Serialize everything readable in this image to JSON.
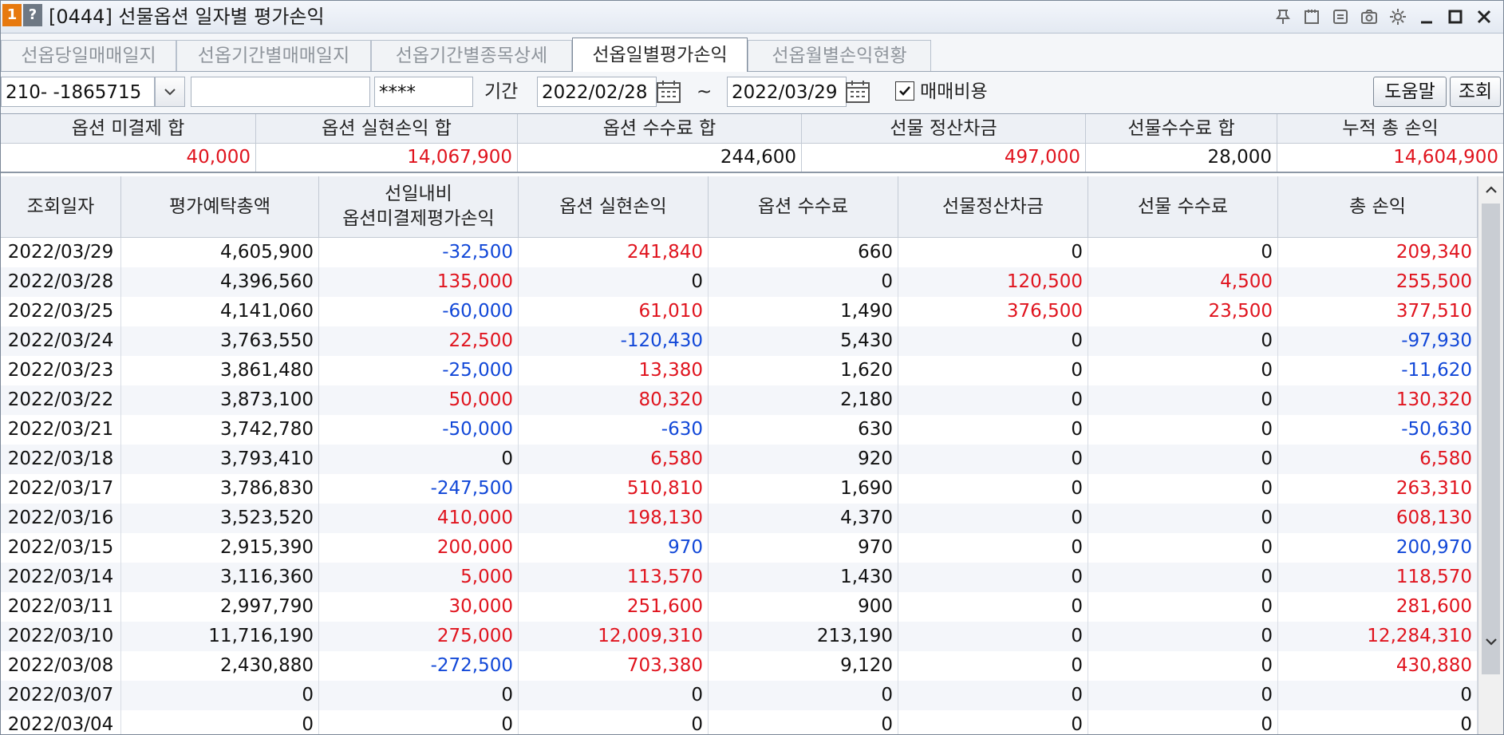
{
  "window": {
    "badge1": "1",
    "badge2": "?",
    "title": "[0444] 선물옵션 일자별 평가손익",
    "icons": [
      "pin-icon",
      "memo-icon",
      "link-icon",
      "camera-icon",
      "gear-icon",
      "minimize-icon",
      "maximize-icon",
      "close-icon"
    ]
  },
  "tabs": [
    {
      "label": "선옵당일매매일지",
      "active": false
    },
    {
      "label": "선옵기간별매매일지",
      "active": false
    },
    {
      "label": "선옵기간별종목상세",
      "active": false
    },
    {
      "label": "선옵일별평가손익",
      "active": true
    },
    {
      "label": "선옵월별손익현황",
      "active": false
    }
  ],
  "search": {
    "account": "210-    -1865715",
    "account_name": "",
    "password": "****",
    "period_label": "기간",
    "start_date": "2022/02/28",
    "tilde": "~",
    "end_date": "2022/03/29",
    "fee_label": "매매비용",
    "fee_checked": true,
    "help_button": "도움말",
    "query_button": "조회"
  },
  "summary": {
    "headers": [
      "옵션 미결제 합",
      "옵션 실현손익 합",
      "옵션 수수료 합",
      "선물 정산차금",
      "선물수수료 합",
      "누적 총 손익"
    ],
    "values": [
      "40,000",
      "14,067,900",
      "244,600",
      "497,000",
      "28,000",
      "14,604,900"
    ],
    "value_signs": [
      "pos",
      "pos",
      "zer",
      "pos",
      "zer",
      "pos"
    ]
  },
  "grid": {
    "headers": [
      "조회일자",
      "평가예탁총액",
      "선일내비\n옵션미결제평가손익",
      "옵션 실현손익",
      "옵션 수수료",
      "선물정산차금",
      "선물 수수료",
      "총 손익"
    ],
    "rows": [
      [
        "2022/03/29",
        "4,605,900",
        "-32,500",
        "241,840",
        "660",
        "0",
        "0",
        "209,340"
      ],
      [
        "2022/03/28",
        "4,396,560",
        "135,000",
        "0",
        "0",
        "120,500",
        "4,500",
        "255,500"
      ],
      [
        "2022/03/25",
        "4,141,060",
        "-60,000",
        "61,010",
        "1,490",
        "376,500",
        "23,500",
        "377,510"
      ],
      [
        "2022/03/24",
        "3,763,550",
        "22,500",
        "-120,430",
        "5,430",
        "0",
        "0",
        "-97,930"
      ],
      [
        "2022/03/23",
        "3,861,480",
        "-25,000",
        "13,380",
        "1,620",
        "0",
        "0",
        "-11,620"
      ],
      [
        "2022/03/22",
        "3,873,100",
        "50,000",
        "80,320",
        "2,180",
        "0",
        "0",
        "130,320"
      ],
      [
        "2022/03/21",
        "3,742,780",
        "-50,000",
        "-630",
        "630",
        "0",
        "0",
        "-50,630"
      ],
      [
        "2022/03/18",
        "3,793,410",
        "0",
        "6,580",
        "920",
        "0",
        "0",
        "6,580"
      ],
      [
        "2022/03/17",
        "3,786,830",
        "-247,500",
        "510,810",
        "1,690",
        "0",
        "0",
        "263,310"
      ],
      [
        "2022/03/16",
        "3,523,520",
        "410,000",
        "198,130",
        "4,370",
        "0",
        "0",
        "608,130"
      ],
      [
        "2022/03/15",
        "2,915,390",
        "200,000",
        "970",
        "970",
        "0",
        "0",
        "200,970"
      ],
      [
        "2022/03/14",
        "3,116,360",
        "5,000",
        "113,570",
        "1,430",
        "0",
        "0",
        "118,570"
      ],
      [
        "2022/03/11",
        "2,997,790",
        "30,000",
        "251,600",
        "900",
        "0",
        "0",
        "281,600"
      ],
      [
        "2022/03/10",
        "11,716,190",
        "275,000",
        "12,009,310",
        "213,190",
        "0",
        "0",
        "12,284,310"
      ],
      [
        "2022/03/08",
        "2,430,880",
        "-272,500",
        "703,380",
        "9,120",
        "0",
        "0",
        "430,880"
      ],
      [
        "2022/03/07",
        "0",
        "0",
        "0",
        "0",
        "0",
        "0",
        "0"
      ],
      [
        "2022/03/04",
        "0",
        "0",
        "0",
        "0",
        "0",
        "0",
        "0"
      ]
    ],
    "color_rules": {
      "positive": "#e0141e",
      "negative": "#1248d8",
      "neutral": "#111111"
    },
    "blue_columns_override": {
      "3": [
        "2022/03/15"
      ],
      "7": [
        "2022/03/15"
      ]
    }
  }
}
